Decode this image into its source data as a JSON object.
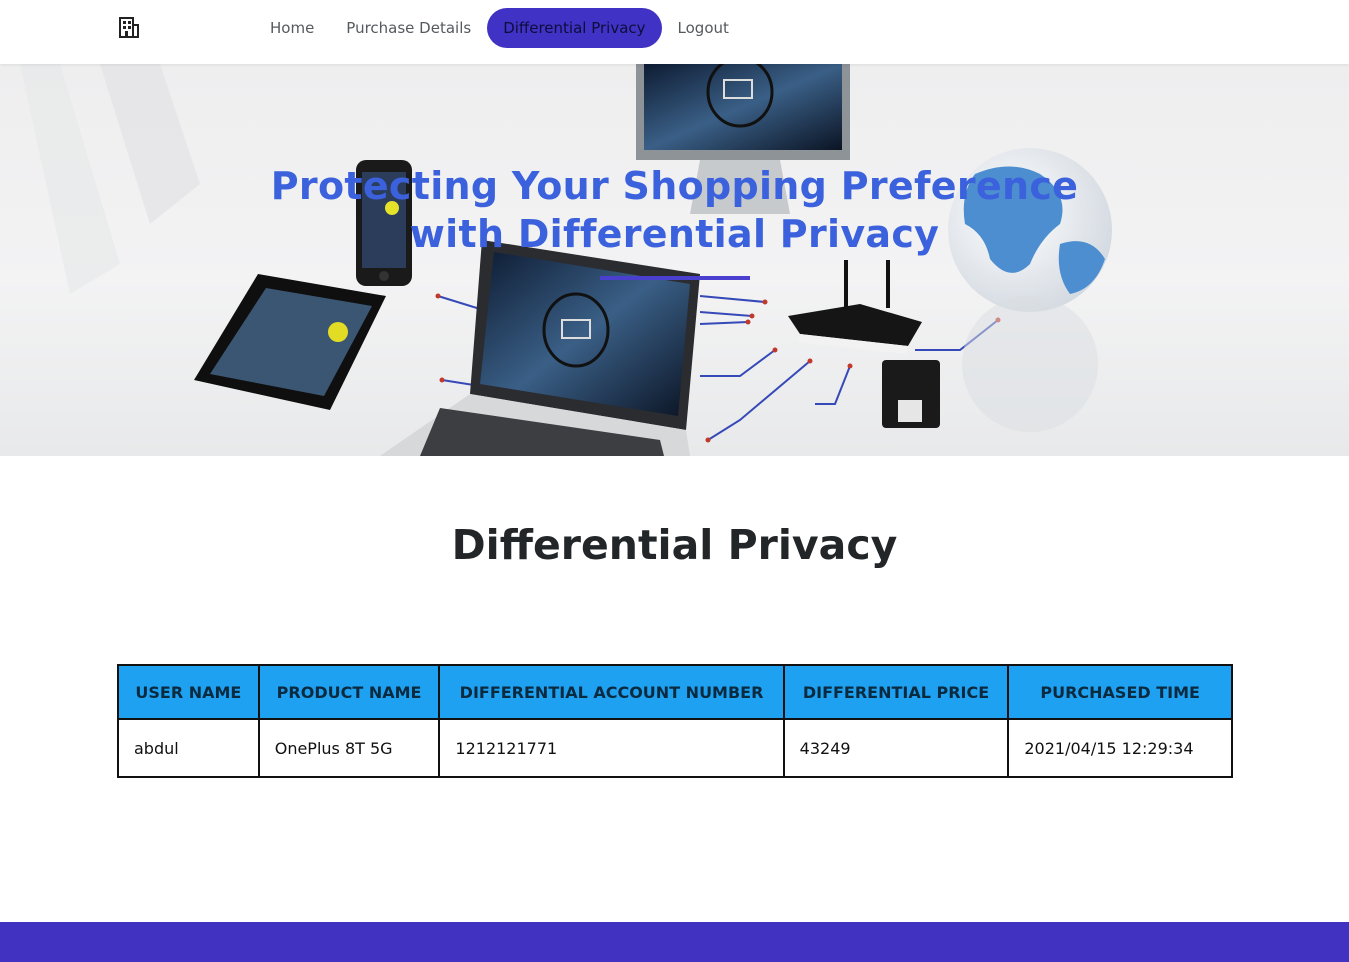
{
  "nav": {
    "brand_icon": "building-icon",
    "items": [
      {
        "label": "Home",
        "active": false
      },
      {
        "label": "Purchase Details",
        "active": false
      },
      {
        "label": "Differential Privacy",
        "active": true
      },
      {
        "label": "Logout",
        "active": false
      }
    ],
    "active_color": "#4032c4"
  },
  "hero": {
    "title_line1": "Protecting Your Shopping Preference",
    "title_line2": "with Differential Privacy",
    "title_color": "#3b62dc",
    "background": "devices-network-illustration"
  },
  "main": {
    "title": "Differential Privacy",
    "table": {
      "header_color": "#1fa1f2",
      "columns": [
        "USER NAME",
        "PRODUCT NAME",
        "DIFFERENTIAL ACCOUNT NUMBER",
        "DIFFERENTIAL PRICE",
        "PURCHASED TIME"
      ],
      "rows": [
        [
          "abdul",
          "OnePlus 8T 5G",
          "1212121771",
          "43249",
          "2021/04/15 12:29:34"
        ]
      ]
    }
  },
  "footer": {
    "color": "#4132c2"
  }
}
